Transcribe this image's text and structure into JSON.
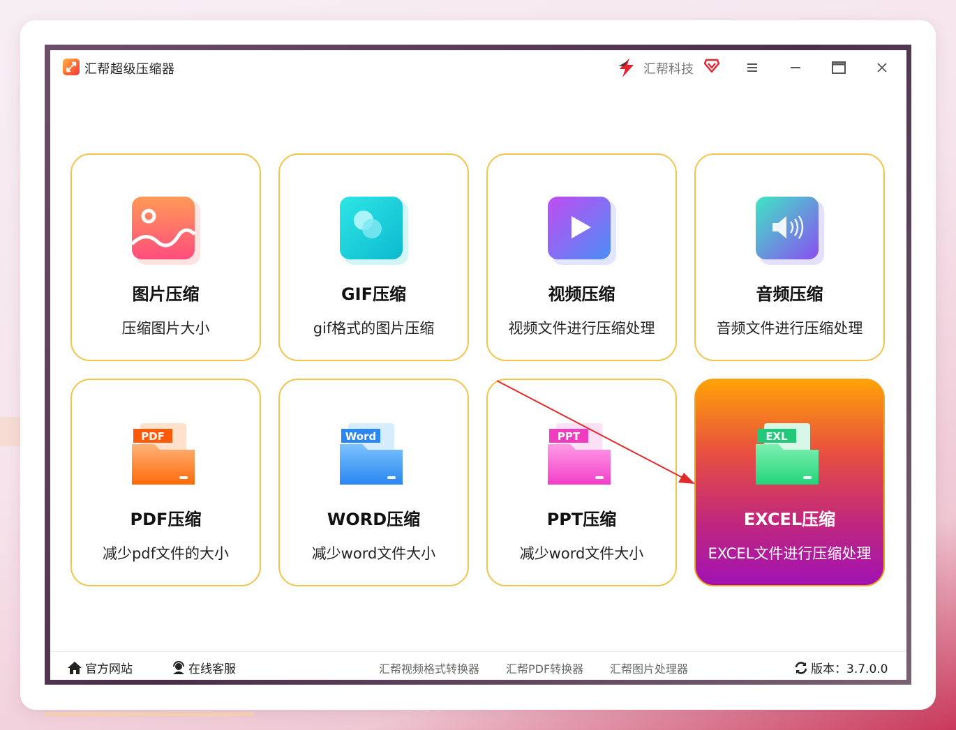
{
  "app": {
    "title": "汇帮超级压缩器",
    "brand": "汇帮科技"
  },
  "cards": [
    {
      "title": "图片压缩",
      "desc": "压缩图片大小",
      "icon": "image-icon"
    },
    {
      "title": "GIF压缩",
      "desc": "gif格式的图片压缩",
      "icon": "gif-icon"
    },
    {
      "title": "视频压缩",
      "desc": "视频文件进行压缩处理",
      "icon": "video-play-icon"
    },
    {
      "title": "音频压缩",
      "desc": "音频文件进行压缩处理",
      "icon": "audio-speaker-icon"
    },
    {
      "title": "PDF压缩",
      "desc": "减少pdf文件的大小",
      "icon": "pdf-folder-icon",
      "tag": "PDF"
    },
    {
      "title": "WORD压缩",
      "desc": "减少word文件大小",
      "icon": "word-folder-icon",
      "tag": "Word"
    },
    {
      "title": "PPT压缩",
      "desc": "减少word文件大小",
      "icon": "ppt-folder-icon",
      "tag": "PPT"
    },
    {
      "title": "EXCEL压缩",
      "desc": "EXCEL文件进行压缩处理",
      "icon": "excel-folder-icon",
      "tag": "EXL",
      "selected": true
    }
  ],
  "footer": {
    "official_site": "官方网站",
    "online_support": "在线客服",
    "links": [
      "汇帮视频格式转换器",
      "汇帮PDF转换器",
      "汇帮图片处理器"
    ],
    "version": "版本：3.7.0.0"
  },
  "colors": {
    "card_border": "#f2c44b",
    "active_gradient_top": "#ffa206",
    "active_gradient_bottom": "#a112b4",
    "annotation_arrow": "#e02b2b"
  }
}
